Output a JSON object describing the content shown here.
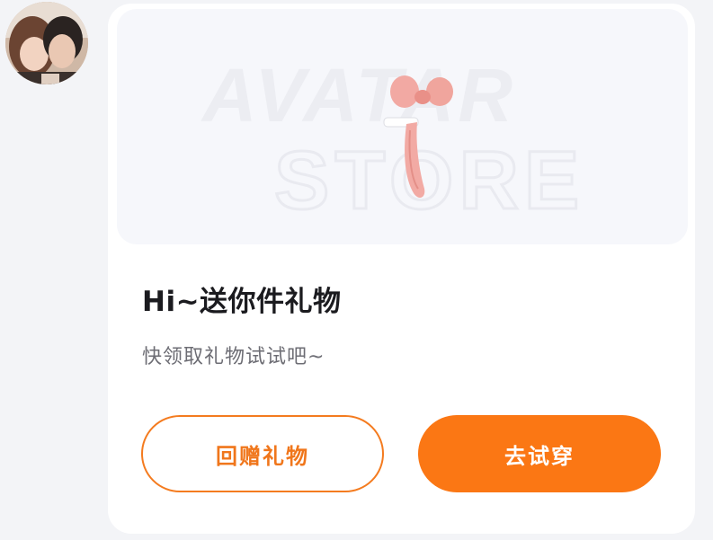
{
  "sender": {
    "avatar_icon": "user-avatar-photo"
  },
  "banner": {
    "watermark_line1": "AVATAR",
    "watermark_line2": "STORE",
    "gift_icon": "pink-ribbon-gift-icon"
  },
  "gift_card": {
    "title": "Hi~送你件礼物",
    "subtitle": "快领取礼物试试吧~"
  },
  "actions": {
    "return_gift_label": "回赠礼物",
    "try_on_label": "去试穿"
  },
  "colors": {
    "accent": "#fb7714",
    "accent_outline": "#f47b1f",
    "ribbon": "#f0a8a0"
  }
}
